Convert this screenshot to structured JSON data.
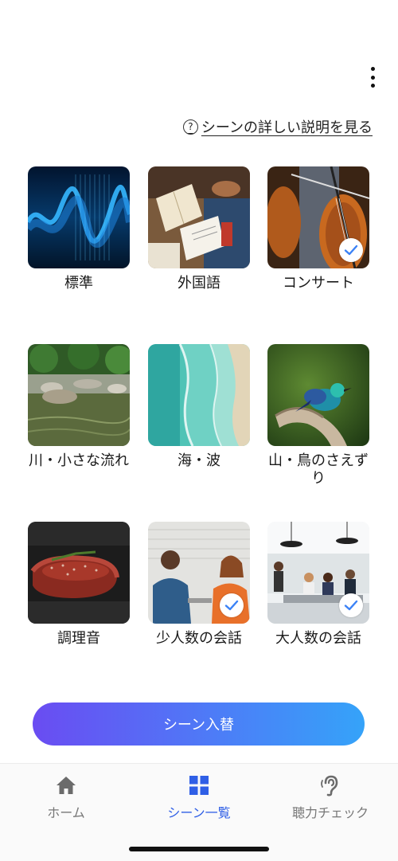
{
  "menu": {
    "icon": "more-vertical-icon"
  },
  "help": {
    "icon": "help-circle-icon",
    "label": "シーンの詳しい説明を見る"
  },
  "scenes": [
    {
      "label": "標準",
      "selected": false
    },
    {
      "label": "外国語",
      "selected": false
    },
    {
      "label": "コンサート",
      "selected": true
    },
    {
      "label": "川・小さな流れ",
      "selected": false
    },
    {
      "label": "海・波",
      "selected": false
    },
    {
      "label": "山・鳥のさえずり",
      "selected": false
    },
    {
      "label": "調理音",
      "selected": false
    },
    {
      "label": "少人数の会話",
      "selected": true
    },
    {
      "label": "大人数の会話",
      "selected": true
    }
  ],
  "swap_button": {
    "label": "シーン入替"
  },
  "tabs": [
    {
      "label": "ホーム",
      "icon": "home-icon",
      "active": false
    },
    {
      "label": "シーン一覧",
      "icon": "grid-icon",
      "active": true
    },
    {
      "label": "聴力チェック",
      "icon": "ear-icon",
      "active": false
    }
  ],
  "colors": {
    "accent": "#2f5fe6",
    "button_gradient_start": "#6a4cf2",
    "button_gradient_end": "#35a3f9",
    "check": "#3b82f6"
  }
}
